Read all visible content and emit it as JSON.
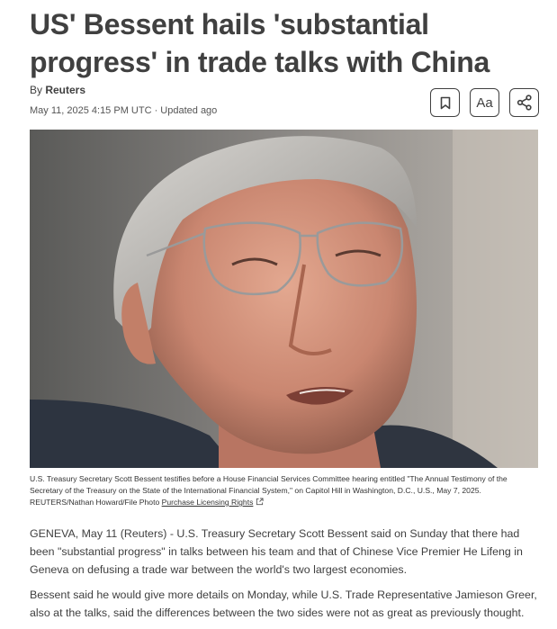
{
  "article": {
    "headline": "US' Bessent hails 'substantial progress' in trade talks with China",
    "by_prefix": "By ",
    "author": "Reuters",
    "dateline": "May 11, 2025 4:15 PM UTC · Updated ago"
  },
  "toolbar": {
    "bookmark_icon": "bookmark-icon",
    "text_size_label": "Aa",
    "share_icon": "share-icon"
  },
  "photo": {
    "caption": "U.S. Treasury Secretary Scott Bessent testifies before a House Financial Services Committee hearing entitled \"The Annual Testimony of the Secretary of the Treasury on the State of the International Financial System,\" on Capitol Hill in Washington, D.C., U.S., May 7, 2025.",
    "credit": "REUTERS/Nathan Howard/File Photo",
    "licensing_link": "Purchase Licensing Rights",
    "external_icon": "external-link-icon"
  },
  "body": {
    "paragraphs": [
      "GENEVA, May 11 (Reuters) - U.S. Treasury Secretary Scott Bessent said on Sunday that there had been \"substantial progress\" in talks between his team and that of Chinese Vice Premier He Lifeng in Geneva on defusing a trade war between the world's two largest economies.",
      "Bessent said he would give more details on Monday, while U.S. Trade Representative Jamieson Greer, also at the talks, said the differences between the two sides were not as great as previously thought."
    ]
  }
}
